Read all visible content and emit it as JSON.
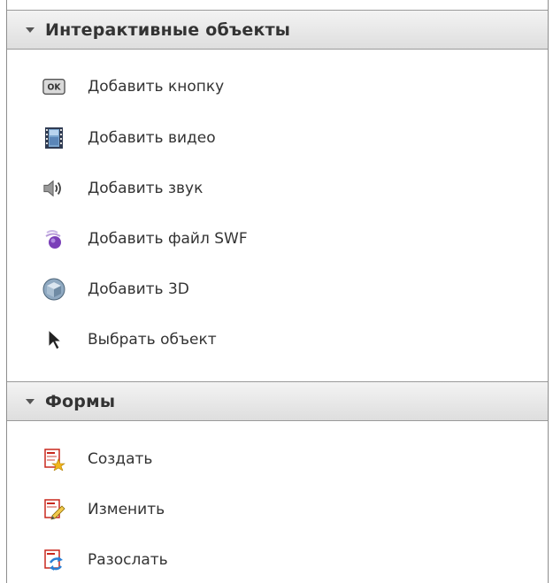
{
  "sections": [
    {
      "title": "Интерактивные объекты",
      "items": [
        {
          "label": "Добавить кнопку",
          "icon": "ok-button-icon"
        },
        {
          "label": "Добавить видео",
          "icon": "film-icon"
        },
        {
          "label": "Добавить звук",
          "icon": "speaker-icon"
        },
        {
          "label": "Добавить файл SWF",
          "icon": "swf-icon"
        },
        {
          "label": "Добавить 3D",
          "icon": "3d-cube-icon"
        },
        {
          "label": "Выбрать объект",
          "icon": "select-cursor-icon"
        }
      ]
    },
    {
      "title": "Формы",
      "items": [
        {
          "label": "Создать",
          "icon": "form-create-icon"
        },
        {
          "label": "Изменить",
          "icon": "form-edit-icon"
        },
        {
          "label": "Разослать",
          "icon": "form-distribute-icon"
        }
      ]
    }
  ],
  "icon_text": {
    "ok": "OK"
  },
  "colors": {
    "header_bg": "#e6e6e6",
    "border": "#8e8e8e",
    "pdf_red": "#c8281e"
  }
}
